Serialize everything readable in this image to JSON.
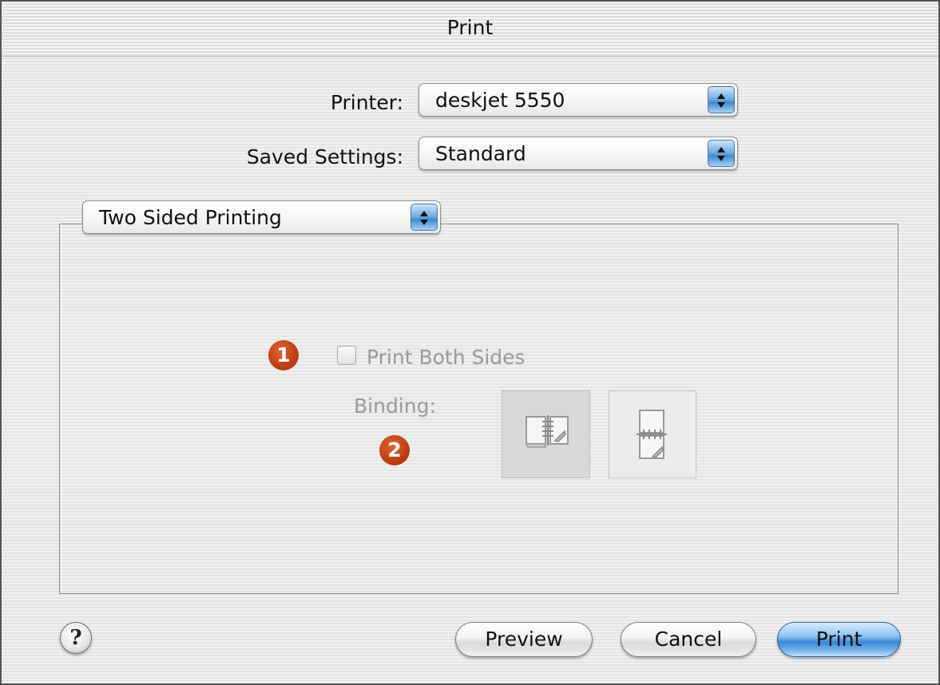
{
  "window": {
    "title": "Print"
  },
  "printer": {
    "label": "Printer:",
    "value": "deskjet 5550"
  },
  "saved_settings": {
    "label": "Saved Settings:",
    "value": "Standard"
  },
  "panel_menu": {
    "value": "Two Sided Printing"
  },
  "two_sided": {
    "print_both_sides_label": "Print Both Sides",
    "print_both_sides_checked": false,
    "binding_label": "Binding:",
    "callout_1": "1",
    "callout_2": "2",
    "binding_options": [
      "long-edge-binding-icon",
      "short-edge-binding-icon"
    ]
  },
  "buttons": {
    "help": "?",
    "preview": "Preview",
    "cancel": "Cancel",
    "print": "Print"
  },
  "colors": {
    "accent": "#3b86d4",
    "callout": "#b8380f",
    "disabled_text": "#9a9a9a"
  }
}
